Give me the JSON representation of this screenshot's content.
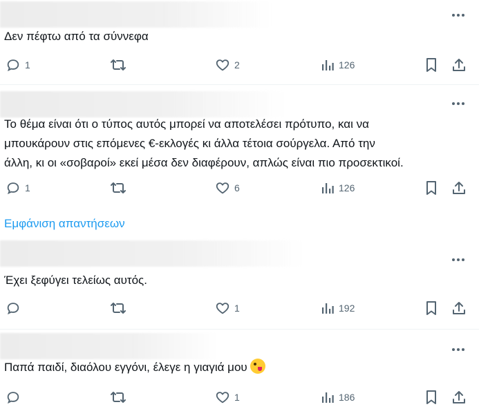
{
  "posts": [
    {
      "text_lines": [
        "Δεν πέφτω από τα σύννεφα"
      ],
      "replies": "1",
      "likes": "2",
      "views": "126"
    },
    {
      "text_lines": [
        "Το θέμα είναι ότι ο τύπος αυτός μπορεί να αποτελέσει πρότυπο, και να",
        "μπουκάρουν στις επόμενες €-εκλογές κι άλλα τέτοια σούργελα. Από την",
        "άλλη, κι οι «σοβαροί» εκεί μέσα δεν διαφέρουν, απλώς είναι πιο προσεκτικοί."
      ],
      "replies": "1",
      "likes": "6",
      "views": "126"
    },
    {
      "text_lines": [
        "Έχει ξεφύγει τελείως αυτός."
      ],
      "replies": "",
      "likes": "1",
      "views": "192"
    },
    {
      "text_lines": [
        "Παπά παιδί, διαόλου εγγόνι, έλεγε  η γιαγιά μου"
      ],
      "emoji": "zany-face-emoji",
      "replies": "",
      "likes": "1",
      "views": "186"
    }
  ],
  "show_replies_label": "Εμφάνιση απαντήσεων",
  "colors": {
    "icon": "#536471",
    "link": "#1d9bf0",
    "text": "#0f1419",
    "divider": "#eff3f4"
  }
}
